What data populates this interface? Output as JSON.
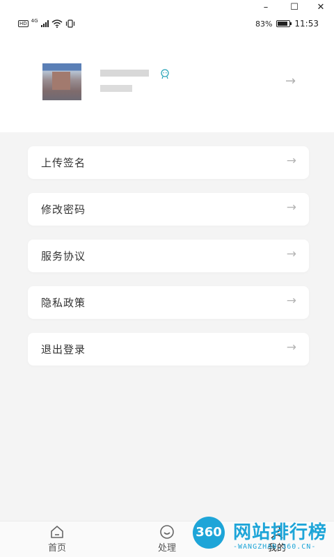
{
  "window": {
    "minimize_glyph": "–",
    "maximize_glyph": "☐",
    "close_glyph": "✕"
  },
  "statusbar": {
    "hd_label": "HD",
    "network_label": "4G",
    "battery_percent": "83%",
    "battery_level": 0.83,
    "time": "11:53"
  },
  "profile": {
    "badge_icon": "mascot-icon",
    "arrow_glyph": "→"
  },
  "menu": {
    "items": [
      {
        "label": "上传签名",
        "arrow": "→"
      },
      {
        "label": "修改密码",
        "arrow": "→"
      },
      {
        "label": "服务协议",
        "arrow": "→"
      },
      {
        "label": "隐私政策",
        "arrow": "→"
      },
      {
        "label": "退出登录",
        "arrow": "→"
      }
    ]
  },
  "tabbar": {
    "tabs": [
      {
        "label": "首页",
        "icon": "home-icon"
      },
      {
        "label": "处理",
        "icon": "smile-icon"
      },
      {
        "label": "我的",
        "icon": "person-icon",
        "active": true
      }
    ]
  },
  "watermark": {
    "logo_text": "360",
    "title": "网站排行榜",
    "subtitle": "-WANGZHAN.360.CN-"
  },
  "colors": {
    "accent": "#1ea5d8",
    "badge": "#2aa4b7",
    "background": "#f4f4f4"
  }
}
